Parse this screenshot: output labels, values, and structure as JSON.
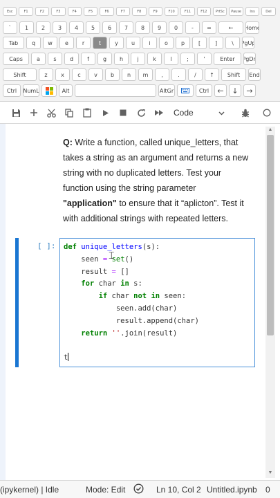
{
  "keyboard": {
    "fn_row": [
      "Esc",
      "F1",
      "F2",
      "F3",
      "F4",
      "F5",
      "F6",
      "F7",
      "F8",
      "F9",
      "F10",
      "F11",
      "F12",
      "PrtSc",
      "Pause",
      "Ins",
      "Del"
    ],
    "number_row": [
      "`",
      "1",
      "2",
      "3",
      "4",
      "5",
      "6",
      "7",
      "8",
      "9",
      "0",
      "-",
      "=",
      "←",
      "Home"
    ],
    "top_row": [
      "Tab",
      "q",
      "w",
      "e",
      "r",
      "t",
      "y",
      "u",
      "i",
      "o",
      "p",
      "[",
      "]",
      "\\",
      "PgUp"
    ],
    "home_row": [
      "Caps",
      "a",
      "s",
      "d",
      "f",
      "g",
      "h",
      "j",
      "k",
      "l",
      ";",
      "'",
      "Enter",
      "PgDn"
    ],
    "bottom_row": [
      "Shift",
      "z",
      "x",
      "c",
      "v",
      "b",
      "n",
      "m",
      ",",
      ".",
      "/",
      "↑",
      "Shift",
      "End"
    ],
    "space_row": {
      "ctrl": "Ctrl",
      "numlock": "NumL",
      "alt": "Alt",
      "altgr": "AltGr",
      "rctrl": "Ctrl",
      "left": "←",
      "down": "↓",
      "right": "→"
    },
    "pressed_key": "t"
  },
  "toolbar": {
    "cell_type": "Code",
    "icons": [
      "save-icon",
      "add-icon",
      "cut-icon",
      "copy-icon",
      "paste-icon",
      "run-icon",
      "stop-icon",
      "restart-icon",
      "fast-forward-icon",
      "chevron-down-icon",
      "bug-icon"
    ]
  },
  "markdown": {
    "q_label": "Q:",
    "line1_rest": " Write a function, called unique_letters, that takes a string as an argument and returns a new string with no duplicated letters. Test your function using the string parameter ",
    "bold_term": "\"application\"",
    "line2_rest": " to ensure that it “aplicton”. Test it with additional strings with repeated letters."
  },
  "cell": {
    "prompt": "[ ]:",
    "code": {
      "l1_def": "def",
      "l1_name": "unique_letters",
      "l1_rest": "(s):",
      "l2_a": "    seen ",
      "l2_op": "=",
      "l2_b": " ",
      "l2_fn": "set",
      "l2_c": "()",
      "l3_a": "    result ",
      "l3_op": "=",
      "l3_b": " []",
      "l4_for": "    for",
      "l4_a": " char ",
      "l4_in": "in",
      "l4_b": " s:",
      "l5_if": "        if",
      "l5_a": " char ",
      "l5_not": "not in",
      "l5_b": " seen:",
      "l6": "            seen.add(char)",
      "l7": "            result.append(char)",
      "l8_ret": "    return",
      "l8_a": " ",
      "l8_str": "''",
      "l8_b": ".join(result)",
      "l9": "",
      "l10": "t"
    }
  },
  "statusbar": {
    "kernel": "(ipykernel) | Idle",
    "mode": "Mode: Edit",
    "position": "Ln 10, Col 2",
    "filename": "Untitled.ipynb",
    "count": "0"
  },
  "colors": {
    "accent": "#1976d2",
    "keyword": "#008000",
    "function_name": "#0000ff",
    "string": "#ba2121",
    "operator": "#aa22ff"
  }
}
